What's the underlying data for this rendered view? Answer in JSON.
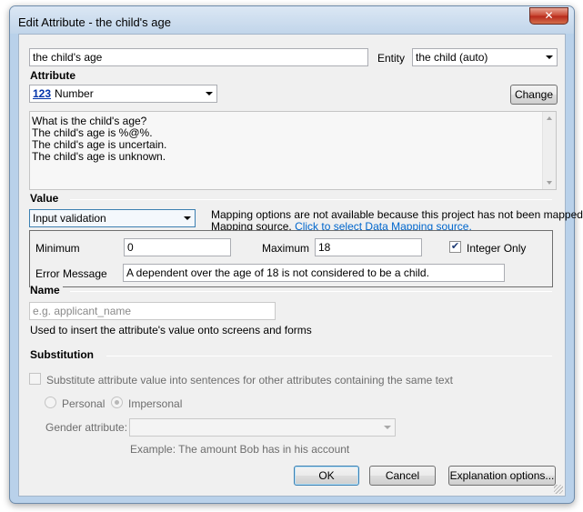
{
  "window": {
    "title": "Edit Attribute - the child's age",
    "close_glyph": "✕"
  },
  "header": {
    "text_value": "the child's age",
    "entity_label": "Entity",
    "entity_value": "the child (auto)"
  },
  "attribute": {
    "heading": "Attribute",
    "type_badge": "123",
    "type_value": "Number",
    "change_label": "Change",
    "sentences": [
      "What is the child's age?",
      "The child's age is %@%.",
      "The child's age is uncertain.",
      "The child's age is unknown."
    ]
  },
  "value": {
    "heading": "Value",
    "mode_value": "Input validation",
    "mapping_note_line1": "Mapping options are not available because this project has not been mapped to",
    "mapping_note_line2_prefix": "Mapping source.",
    "mapping_link": "Click to select Data Mapping source.",
    "minimum_label": "Minimum",
    "minimum_value": "0",
    "maximum_label": "Maximum",
    "maximum_value": "18",
    "integer_only_label": "Integer Only",
    "integer_only_checked": true,
    "integer_only_glyph": "✔",
    "error_label": "Error Message",
    "error_value": "A dependent over the age of 18 is not considered to be a child."
  },
  "name": {
    "heading": "Name",
    "placeholder": "e.g. applicant_name",
    "help": "Used to insert the attribute's value onto screens and forms"
  },
  "substitution": {
    "heading": "Substitution",
    "checkbox_label": "Substitute attribute value into sentences for other attributes containing the same text",
    "personal_label": "Personal",
    "impersonal_label": "Impersonal",
    "gender_label": "Gender attribute:",
    "example": "Example: The amount Bob has in his account"
  },
  "footer": {
    "ok_label": "OK",
    "cancel_label": "Cancel",
    "explanation_label": "Explanation options..."
  },
  "colors": {
    "frame": "#b9d1ea",
    "client": "#f0f0f0",
    "link": "#0066cc",
    "close": "#c7442e"
  }
}
